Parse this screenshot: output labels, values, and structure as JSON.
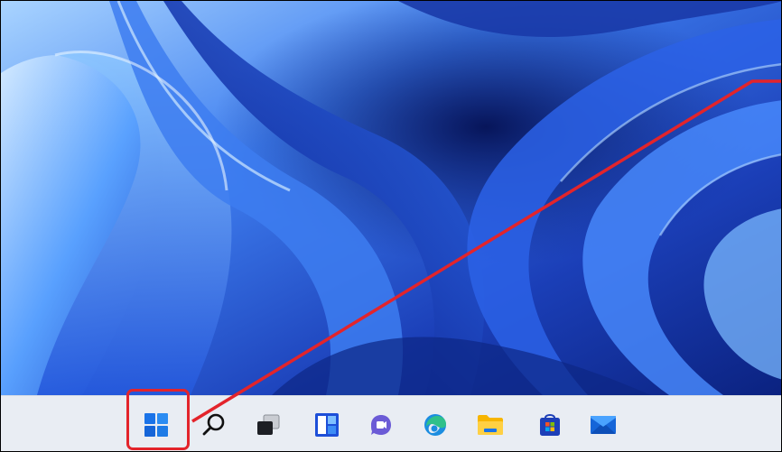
{
  "desktop": {
    "wallpaper": "windows-11-bloom",
    "colors": {
      "deep": "#0a1f6e",
      "mid": "#1d4fd8",
      "light": "#6fb6ff",
      "pale": "#cfe8ff"
    }
  },
  "taskbar": {
    "background": "#e9edf3",
    "icons": [
      {
        "name": "start-button",
        "icon": "windows-logo-icon"
      },
      {
        "name": "search-button",
        "icon": "search-icon"
      },
      {
        "name": "task-view-button",
        "icon": "task-view-icon"
      },
      {
        "name": "widgets-button",
        "icon": "widgets-icon"
      },
      {
        "name": "chat-button",
        "icon": "teams-chat-icon"
      },
      {
        "name": "edge-button",
        "icon": "edge-icon"
      },
      {
        "name": "file-explorer-button",
        "icon": "folder-icon"
      },
      {
        "name": "store-button",
        "icon": "store-icon"
      },
      {
        "name": "mail-button",
        "icon": "mail-icon"
      }
    ]
  },
  "annotation": {
    "highlight_color": "#e3242b",
    "target": "start-button"
  }
}
